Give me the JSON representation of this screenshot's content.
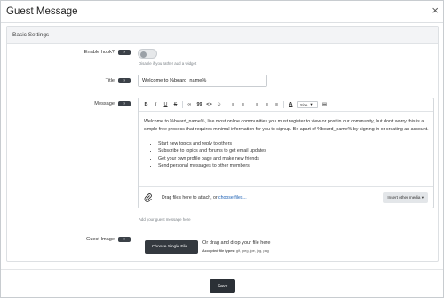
{
  "modal": {
    "title": "Guest Message",
    "close_icon": "close-icon"
  },
  "section": {
    "title": "Basic Settings"
  },
  "help_badge_label": "?",
  "enable_hook": {
    "label": "Enable hook?",
    "hint": "Disable if you rather add a widget",
    "enabled": false
  },
  "title_field": {
    "label": "Title",
    "value": "Welcome to %board_name%"
  },
  "message": {
    "label": "Message",
    "toolbar": {
      "bold": "B",
      "italic": "I",
      "underline": "U",
      "strike": "S",
      "link": "∞",
      "quote": "99",
      "code": "<>",
      "emoji": "☺",
      "bullet_list": "≡",
      "numbered_list": "≡",
      "align_left": "≡",
      "align_center": "≡",
      "align_right": "≡",
      "text_color": "A",
      "size_label": "Size",
      "source": "▤"
    },
    "body_paragraph": "Welcome to %board_name%, like most online communities you must register to view or post in our community, but don't worry this is a simple free process that requires minimal information for you to signup. Be apart of %board_name% by signing in or creating an account.",
    "list_items": [
      "Start new topics and reply to others",
      "Subscribe to topics and forums to get email updates",
      "Get your own profile page and make new friends",
      "Send personal messages to other members."
    ],
    "attach_text": "Drag files here to attach, or",
    "attach_link": "choose files...",
    "insert_media": "Insert other media ▾",
    "hint": "Add your guest message here"
  },
  "guest_image": {
    "label": "Guest Image",
    "button": "Choose Single File...",
    "drop_text": "Or drag and drop your file here",
    "accepted_label": "Accepted file types:",
    "accepted_types": "gif, jpeg, jpe, jpg, png"
  },
  "save_button": "Save"
}
